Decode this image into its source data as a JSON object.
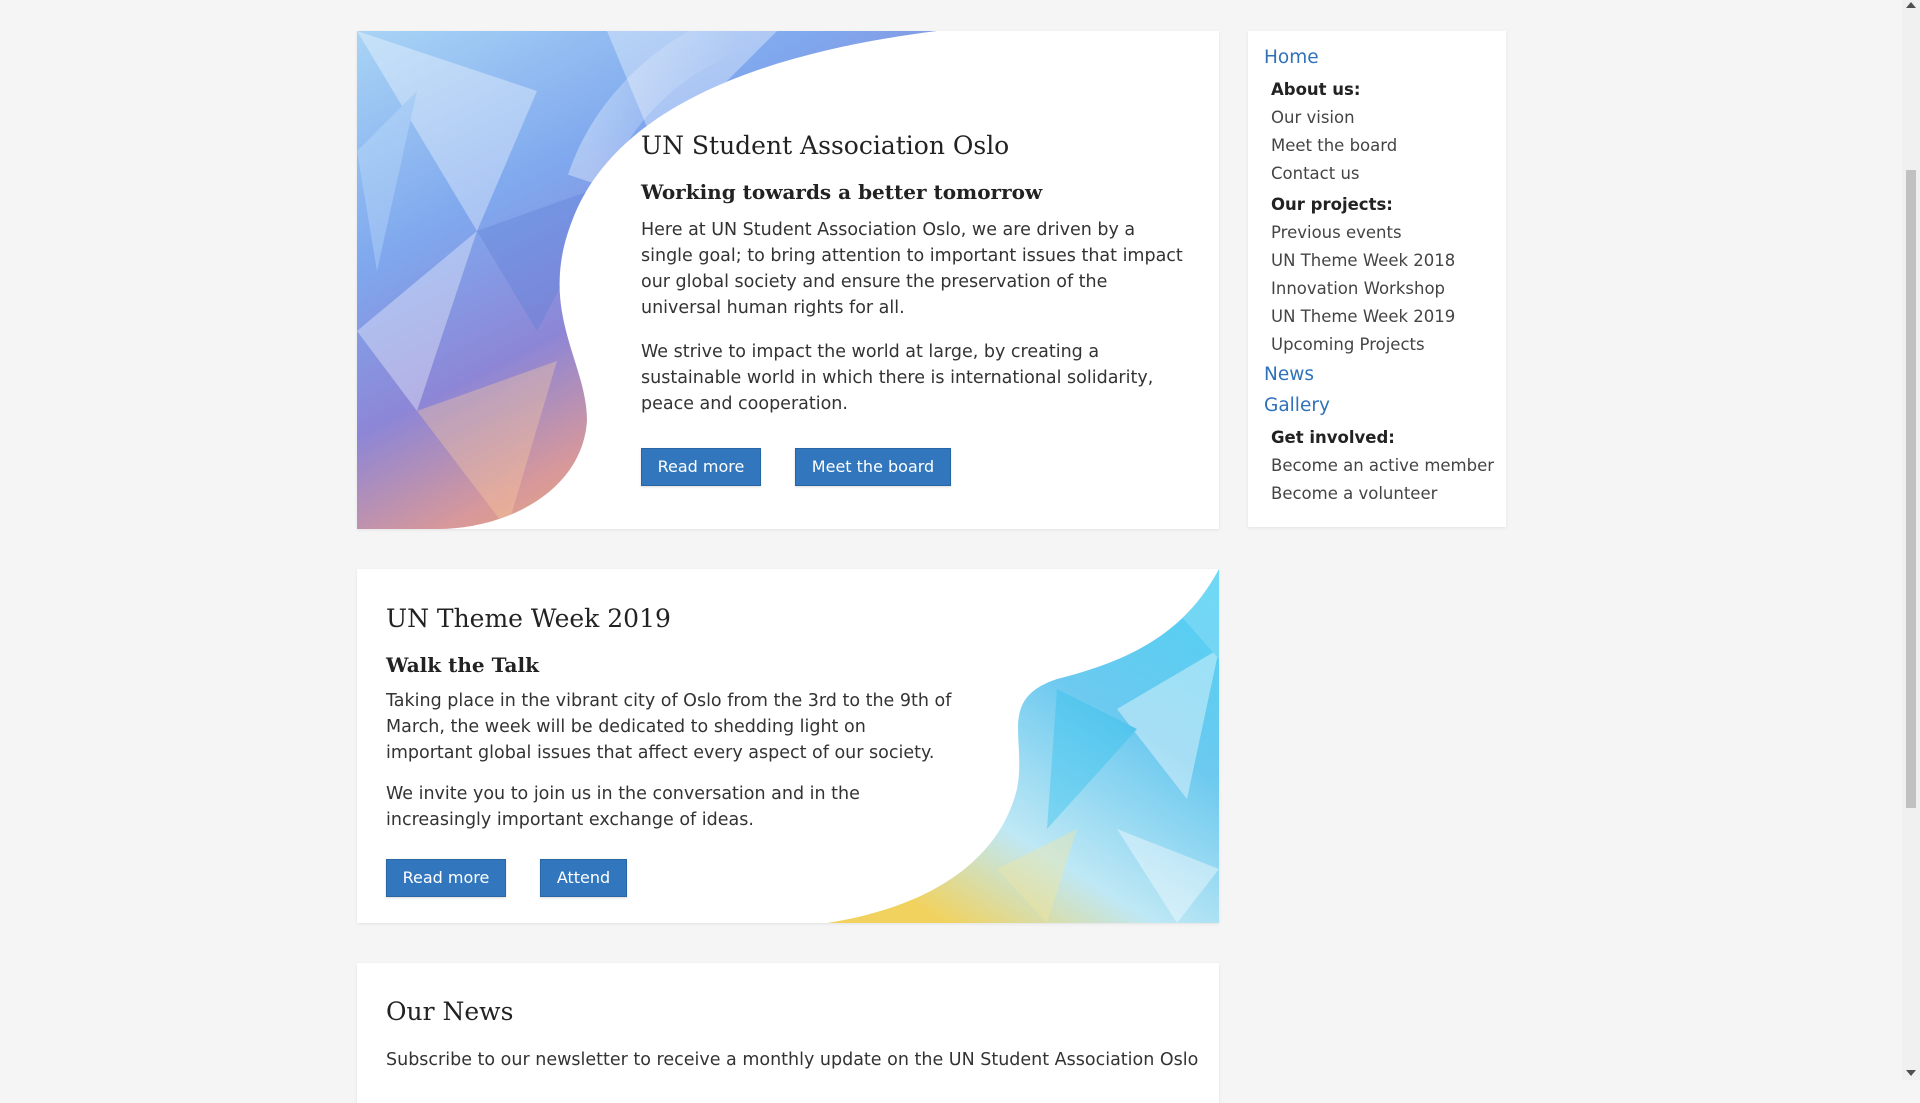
{
  "hero": {
    "title": "UN Student Association Oslo",
    "subtitle": "Working towards a better tomorrow",
    "para1": "Here at UN Student Association Oslo, we are driven by a single goal; to bring attention to important issues that impact our global society and ensure the preservation of the universal human rights for all.",
    "para2": "We strive to impact the world at large, by creating a sustainable world in which there is international solidarity, peace and cooperation.",
    "buttons": [
      "Read more",
      "Meet the board"
    ]
  },
  "theme_week": {
    "title": "UN Theme Week 2019",
    "subtitle": "Walk the Talk",
    "para1": "Taking place in the vibrant city of Oslo from the 3rd to the 9th of March, the week will be dedicated to shedding light on important global issues that affect every aspect of our society.",
    "para2": "We invite you to join us in the conversation and in the increasingly important exchange of ideas.",
    "buttons": [
      "Read more",
      "Attend"
    ]
  },
  "news": {
    "title": "Our News",
    "text": "Subscribe to our newsletter to receive a monthly update on the UN Student Association Oslo"
  },
  "sidebar": {
    "home": "Home",
    "about_heading": "About us:",
    "about_items": [
      "Our vision",
      "Meet the board",
      "Contact us"
    ],
    "projects_heading": "Our projects:",
    "project_items": [
      "Previous events",
      "UN Theme Week 2018",
      "Innovation Workshop",
      "UN Theme Week 2019",
      "Upcoming Projects"
    ],
    "news": "News",
    "gallery": "Gallery",
    "involved_heading": "Get involved:",
    "involved_items": [
      "Become an active member",
      "Become a volunteer"
    ]
  },
  "colors": {
    "accent": "#3277bd",
    "link": "#2f72ba",
    "background": "#f5f5f5"
  }
}
